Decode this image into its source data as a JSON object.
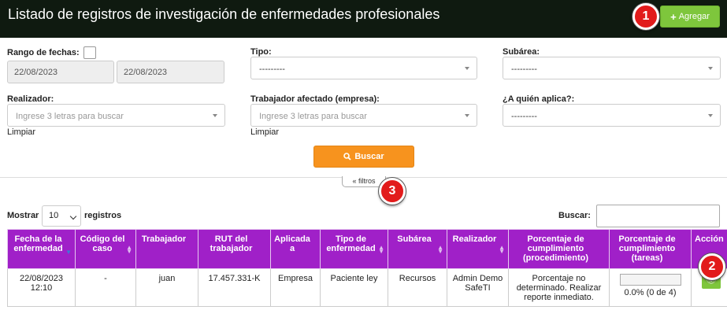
{
  "header": {
    "title": "Listado de registros de investigación de enfermedades profesionales",
    "add_label": "Agregar"
  },
  "filters": {
    "date_range_label": "Rango de fechas:",
    "date_from": "22/08/2023",
    "date_to": "22/08/2023",
    "tipo_label": "Tipo:",
    "tipo_value": "---------",
    "subarea_label": "Subárea:",
    "subarea_value": "---------",
    "realizador_label": "Realizador:",
    "realizador_placeholder": "Ingrese 3 letras para buscar",
    "trabajador_label": "Trabajador afectado (empresa):",
    "trabajador_placeholder": "Ingrese 3 letras para buscar",
    "aplica_label": "¿A quién aplica?:",
    "aplica_value": "---------",
    "clear_label": "Limpiar",
    "search_label": "Buscar",
    "toggle_label": "filtros"
  },
  "annotations": [
    "1",
    "2",
    "3"
  ],
  "table_controls": {
    "show_label": "Mostrar",
    "page_length": "10",
    "records_label": "registros",
    "search_label": "Buscar:"
  },
  "table": {
    "headers": [
      "Fecha de la enfermedad",
      "Código del caso",
      "Trabajador",
      "RUT del trabajador",
      "Aplicada a",
      "Tipo de enfermedad",
      "Subárea",
      "Realizador",
      "Porcentaje de cumplimiento (procedimiento)",
      "Porcentaje de cumplimiento (tareas)",
      "Acción"
    ],
    "rows": [
      {
        "fecha": "22/08/2023 12:10",
        "codigo": "-",
        "trabajador": "juan",
        "rut": "17.457.331-K",
        "aplicada": "Empresa",
        "tipo": "Paciente ley",
        "subarea": "Recursos",
        "realizador": "Admin Demo SafeTI",
        "procedimiento": "Porcentaje no determinado. Realizar reporte inmediato.",
        "tareas_text": "0.0% (0 de 4)",
        "tareas_progress": 0.0
      }
    ]
  },
  "colors": {
    "header_bg": "#0f1a10",
    "table_header": "#a020c8",
    "green_button": "#7ec63c",
    "orange_button": "#f7931e",
    "badge": "#e21b1b"
  }
}
